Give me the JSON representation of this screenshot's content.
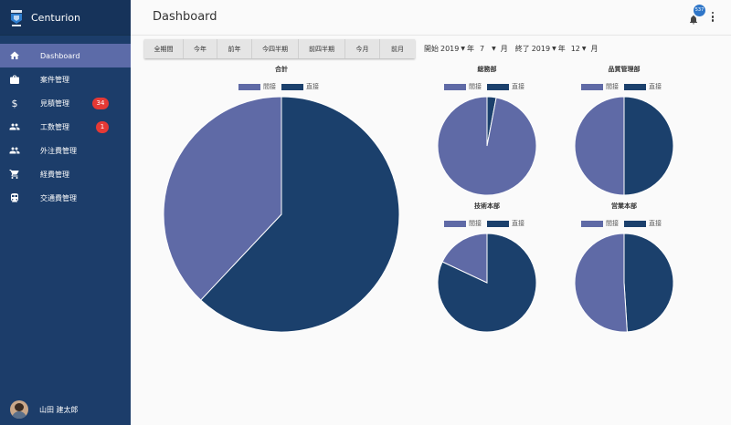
{
  "app": {
    "name": "Centurion"
  },
  "sidebar": {
    "items": [
      {
        "label": "Dashboard",
        "icon": "home-icon",
        "active": true
      },
      {
        "label": "案件管理",
        "icon": "briefcase-icon"
      },
      {
        "label": "見積管理",
        "icon": "dollar-icon",
        "badge": "34"
      },
      {
        "label": "工数管理",
        "icon": "people-icon",
        "badge": "1"
      },
      {
        "label": "外注費管理",
        "icon": "people-icon"
      },
      {
        "label": "経費管理",
        "icon": "cart-icon"
      },
      {
        "label": "交通費管理",
        "icon": "train-icon"
      }
    ],
    "user": {
      "name": "山田 建太郎"
    }
  },
  "header": {
    "title": "Dashboard",
    "notification_count": "537"
  },
  "toolbar": {
    "periods": [
      "全期間",
      "今年",
      "前年",
      "今四半期",
      "前四半期",
      "今月",
      "前月"
    ],
    "range": {
      "start_label": "開始",
      "start_year": "2019",
      "start_month": "7",
      "end_label": "終了",
      "end_year": "2019",
      "end_month": "12",
      "year_unit": "年",
      "month_unit": "月"
    }
  },
  "legend": {
    "indirect": "間接",
    "direct": "直接"
  },
  "colors": {
    "indirect": "#5f6aa6",
    "direct": "#1b406c",
    "sidebar": "#1c3d6a",
    "active": "#5c6ba8",
    "badge": "#e53935"
  },
  "chart_data": [
    {
      "type": "pie",
      "title": "合計",
      "categories": [
        "間接",
        "直接"
      ],
      "values": [
        38,
        62
      ]
    },
    {
      "type": "pie",
      "title": "総務部",
      "categories": [
        "間接",
        "直接"
      ],
      "values": [
        97,
        3
      ]
    },
    {
      "type": "pie",
      "title": "品質管理部",
      "categories": [
        "間接",
        "直接"
      ],
      "values": [
        50,
        50
      ]
    },
    {
      "type": "pie",
      "title": "技術本部",
      "categories": [
        "間接",
        "直接"
      ],
      "values": [
        18,
        82
      ]
    },
    {
      "type": "pie",
      "title": "営業本部",
      "categories": [
        "間接",
        "直接"
      ],
      "values": [
        51,
        49
      ]
    }
  ]
}
